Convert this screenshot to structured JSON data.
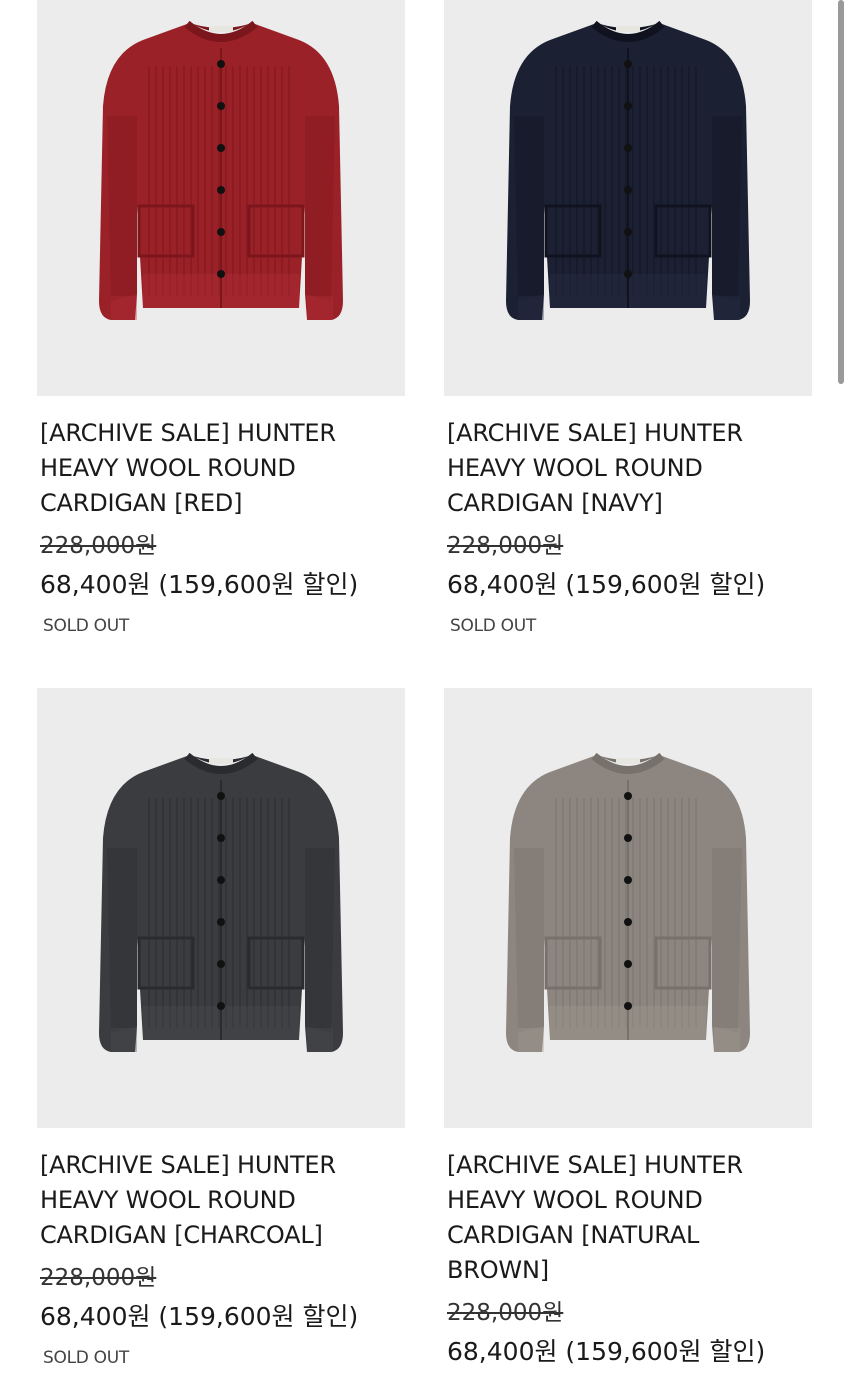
{
  "products": [
    {
      "title": "[ARCHIVE SALE] HUNTER HEAVY WOOL ROUND CARDIGAN [RED]",
      "original_price": "228,000원",
      "sale_price": "68,400원 (159,600원 할인)",
      "status": "SOLD OUT",
      "colors": {
        "body": "#9b2128",
        "shade": "#7a161c",
        "light": "#b13038"
      }
    },
    {
      "title": "[ARCHIVE SALE] HUNTER HEAVY WOOL ROUND CARDIGAN [NAVY]",
      "original_price": "228,000원",
      "sale_price": "68,400원 (159,600원 할인)",
      "status": "SOLD OUT",
      "colors": {
        "body": "#1b2033",
        "shade": "#10131f",
        "light": "#2a3047"
      }
    },
    {
      "title": "[ARCHIVE SALE] HUNTER HEAVY WOOL ROUND CARDIGAN [CHARCOAL]",
      "original_price": "228,000원",
      "sale_price": "68,400원 (159,600원 할인)",
      "status": "SOLD OUT",
      "colors": {
        "body": "#3b3c3f",
        "shade": "#2a2b2e",
        "light": "#4d4e52"
      }
    },
    {
      "title": "[ARCHIVE SALE] HUNTER HEAVY WOOL ROUND CARDIGAN [NATURAL BROWN]",
      "original_price": "228,000원",
      "sale_price": "68,400원 (159,600원 할인)",
      "status": "",
      "colors": {
        "body": "#8d8680",
        "shade": "#77716b",
        "light": "#a19a93"
      }
    }
  ]
}
